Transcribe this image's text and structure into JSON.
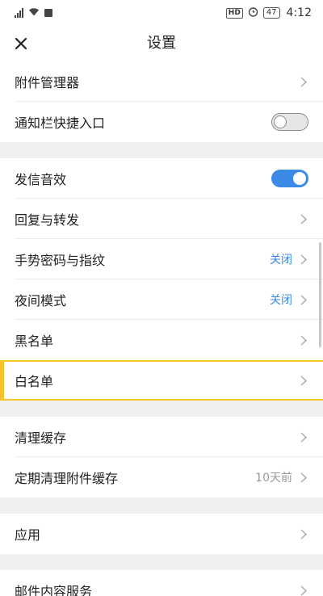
{
  "status_bar": {
    "hd": "HD",
    "battery": "47",
    "time": "4:12"
  },
  "header": {
    "title": "设置"
  },
  "settings": {
    "attachment_manager": {
      "label": "附件管理器"
    },
    "notification_shortcut": {
      "label": "通知栏快捷入口",
      "enabled": false
    },
    "send_sound": {
      "label": "发信音效",
      "enabled": true
    },
    "reply_forward": {
      "label": "回复与转发"
    },
    "gesture_password": {
      "label": "手势密码与指纹",
      "value": "关闭"
    },
    "night_mode": {
      "label": "夜间模式",
      "value": "关闭"
    },
    "blacklist": {
      "label": "黑名单"
    },
    "whitelist": {
      "label": "白名单"
    },
    "clear_cache": {
      "label": "清理缓存"
    },
    "auto_clear_attachments": {
      "label": "定期清理附件缓存",
      "value": "10天前"
    },
    "apps": {
      "label": "应用"
    },
    "mail_content_service": {
      "label": "邮件内容服务"
    }
  },
  "colors": {
    "accent_blue": "#3b8be6",
    "value_gray": "#999999",
    "highlight_yellow": "#f5c22a",
    "section_gap": "#f0f0f2"
  }
}
